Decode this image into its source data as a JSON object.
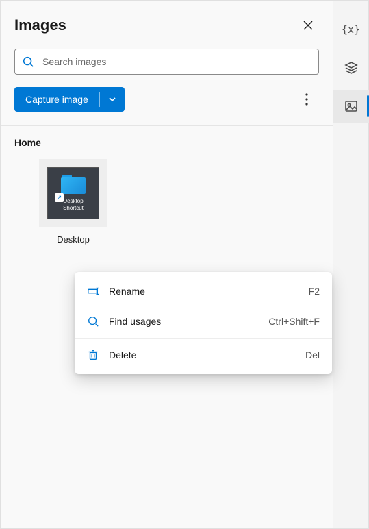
{
  "header": {
    "title": "Images"
  },
  "search": {
    "placeholder": "Search images",
    "value": ""
  },
  "toolbar": {
    "capture_label": "Capture image"
  },
  "section": {
    "title": "Home"
  },
  "items": [
    {
      "caption": "Desktop",
      "thumb_label_line1": "Desktop",
      "thumb_label_line2": "Shortcut",
      "shortcut_glyph": "↗"
    }
  ],
  "context_menu": {
    "rename": {
      "label": "Rename",
      "shortcut": "F2"
    },
    "findusages": {
      "label": "Find usages",
      "shortcut": "Ctrl+Shift+F"
    },
    "delete": {
      "label": "Delete",
      "shortcut": "Del"
    }
  },
  "rail": {
    "variables_icon": "{x}",
    "layers_icon": "layers",
    "images_icon": "image"
  }
}
